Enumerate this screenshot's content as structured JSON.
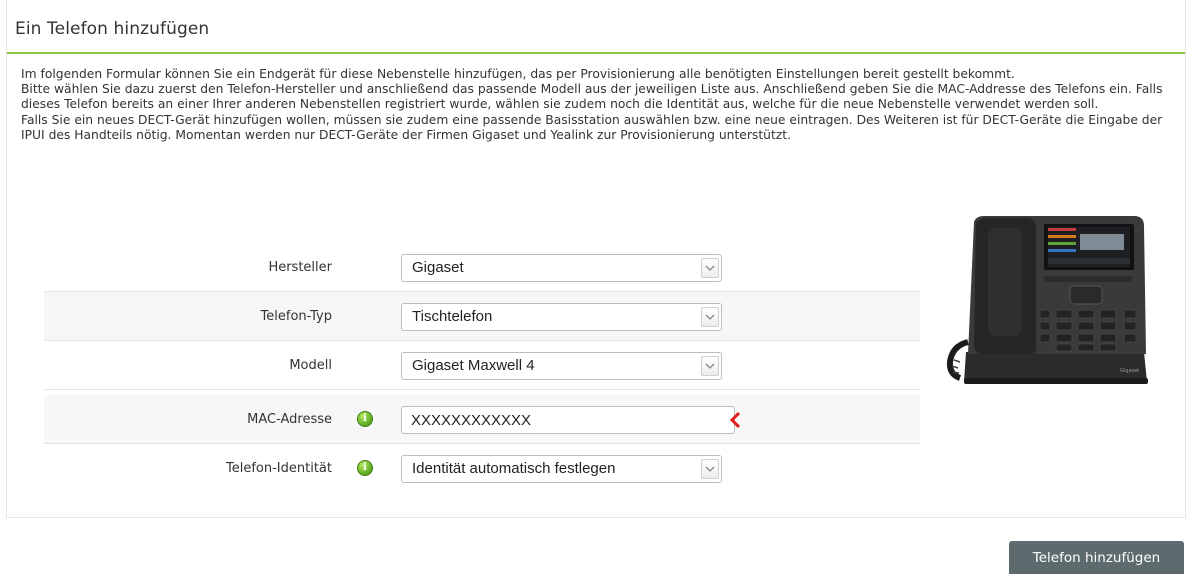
{
  "panel": {
    "title": "Ein Telefon hinzufügen",
    "intro": [
      "Im folgenden Formular können Sie ein Endgerät für diese Nebenstelle hinzufügen, das per Provisionierung alle benötigten Einstellungen bereit gestellt bekommt.",
      "Bitte wählen Sie dazu zuerst den Telefon-Hersteller und anschließend das passende Modell aus der jeweiligen Liste aus. Anschließend geben Sie die MAC-Addresse des Telefons ein. Falls dieses Telefon bereits an einer Ihrer anderen Nebenstellen registriert wurde, wählen sie zudem noch die Identität aus, welche für die neue Nebenstelle verwendet werden soll.",
      "Falls Sie ein neues DECT-Gerät hinzufügen wollen, müssen sie zudem eine passende Basisstation auswählen bzw. eine neue eintragen. Des Weiteren ist für DECT-Geräte die Eingabe der IPUI des Handteils nötig. Momentan werden nur DECT-Geräte der Firmen Gigaset und Yealink zur Provisionierung unterstützt."
    ]
  },
  "form": {
    "manufacturer": {
      "label": "Hersteller",
      "value": "Gigaset"
    },
    "phone_type": {
      "label": "Telefon-Typ",
      "value": "Tischtelefon"
    },
    "model": {
      "label": "Modell",
      "value": "Gigaset Maxwell 4"
    },
    "mac": {
      "label": "MAC-Adresse",
      "value": "XXXXXXXXXXXX",
      "info_icon": "info-icon",
      "status": "invalid"
    },
    "identity": {
      "label": "Telefon-Identität",
      "value": "Identität automatisch festlegen",
      "info_icon": "info-icon"
    }
  },
  "image": {
    "brand_text": "Gigaset"
  },
  "actions": {
    "submit_label": "Telefon hinzufügen"
  },
  "colors": {
    "accent_green": "#8cc63f",
    "button_bg": "#5d6b6e",
    "error_red": "#e02020",
    "info_green": "#6cb82a"
  }
}
